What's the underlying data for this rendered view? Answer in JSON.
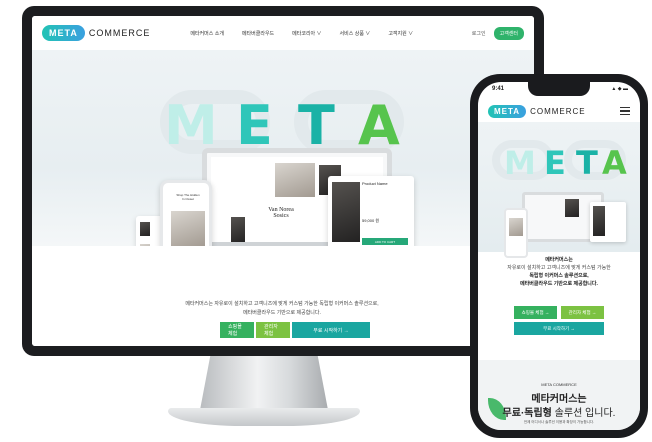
{
  "brand": {
    "logo_mark": "META",
    "logo_word": "COMMERCE",
    "hero_word": "META",
    "accent_teal": "#1aa6a0",
    "accent_green": "#35b15f",
    "accent_lime": "#7cc242"
  },
  "desktop": {
    "menu": [
      "메타커머스 소개",
      "메타버클라우드",
      "메타코리아 ∨",
      "서비스 상품 ∨",
      "고객지원 ∨"
    ],
    "login": "로그인",
    "cta": "고객센터",
    "lap_title": "Van Norea\nSosics",
    "phone_text": "Shop The Hidden\nIn Closet",
    "product_title": "Product Name",
    "product_price": "59,000 원",
    "product_btn": "ADD TO CART",
    "desc_line1": "메타커머스는 자유로이 설치하고 고객니즈에 맞게 커스텀 가능한 독립형 이커머스 솔루션으로,",
    "desc_line2": "메타버클라우드 기반으로 제공합니다.",
    "btn1": "쇼핑몰 체험",
    "btn2": "관리자 체험",
    "btn3": "무료 시작하기 →"
  },
  "mobile": {
    "time": "9:41",
    "status": "▲ ◆ ▬",
    "text_line1": "메타커머스는",
    "text_line2": "자유로이 설치하고 고객니즈에 맞게 커스텀 가능한",
    "text_line3": "독립형 이커머스 솔루션으로,",
    "text_line4": "메타버클라우드 기반으로 제공합니다.",
    "btn1": "쇼핑몰 체험 →",
    "btn2": "관리자 체험 →",
    "btn3": "무료 시작하기 →",
    "brand_small": "META COMMERCE",
    "headline1": "메타커머스는",
    "headline2_bold": "무료·독립형",
    "headline2_rest": " 솔루션 입니다.",
    "sub": "언제 어디서나 솔루션 이용과 확장이 가능합니다."
  }
}
